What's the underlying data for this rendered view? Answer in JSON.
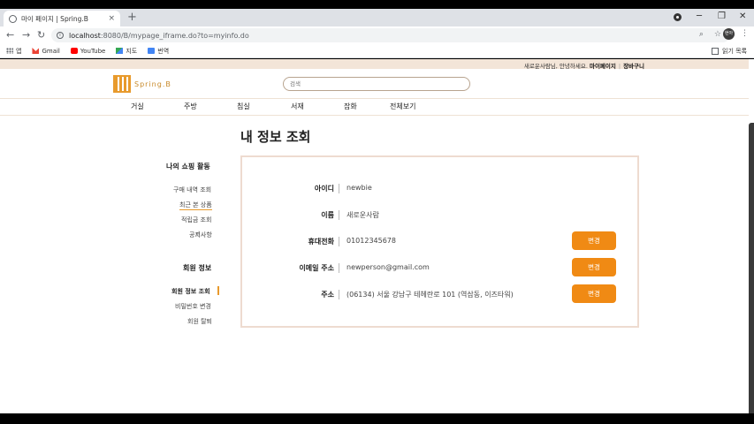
{
  "browser": {
    "tab_title": "마이 페이지 | Spring.B",
    "tab_close": "×",
    "new_tab": "+",
    "url_host": "localhost",
    "url_path": ":8080/B/mypage_iframe.do?to=myinfo.do",
    "profile_initials": "현아",
    "win_minimize": "─",
    "win_restore": "❐",
    "win_close": "✕",
    "nav_back": "←",
    "nav_forward": "→",
    "nav_reload": "↻",
    "zoom_icon": "⌕",
    "star_icon": "☆",
    "kebab": "⋮"
  },
  "bookmarks": {
    "items": [
      {
        "label": "앱",
        "icon": "apps-icon"
      },
      {
        "label": "Gmail",
        "icon": "gmail-icon"
      },
      {
        "label": "YouTube",
        "icon": "youtube-icon"
      },
      {
        "label": "지도",
        "icon": "maps-icon"
      },
      {
        "label": "번역",
        "icon": "translate-icon"
      }
    ],
    "reading_list": "읽기 목록"
  },
  "site": {
    "greeting": "새로운사람님, 안녕하세요.",
    "mypage_link": "마이페이지",
    "cart_link": "장바구니",
    "separator": "|",
    "logo_text": "Spring.B",
    "search_placeholder": "검색",
    "categories": [
      "거실",
      "주방",
      "침실",
      "서재",
      "잡화",
      "전체보기"
    ]
  },
  "page_title": "내 정보 조회",
  "sidebar": {
    "shopping_heading": "나의 쇼핑 활동",
    "shopping_items": [
      "구매 내역 조회",
      "최근 본 상품",
      "적립금 조회",
      "공지사항"
    ],
    "member_heading": "회원 정보",
    "member_items": [
      "회원 정보 조회",
      "비밀번호 변경",
      "회원 탈퇴"
    ]
  },
  "info": {
    "rows": [
      {
        "label": "아이디",
        "value": "newbie"
      },
      {
        "label": "이름",
        "value": "새로운사람"
      },
      {
        "label": "휴대전화",
        "value": "01012345678",
        "button": "변경"
      },
      {
        "label": "이메일 주소",
        "value": "newperson@gmail.com",
        "button": "변경"
      },
      {
        "label": "주소",
        "value": "(06134) 서울 강남구 테헤란로 101 (역삼동, 이즈타워)",
        "button": "변경"
      }
    ]
  },
  "colors": {
    "accent": "#f08a14",
    "top_strip": "#f3e5d8",
    "box_border": "#eedbd0"
  }
}
